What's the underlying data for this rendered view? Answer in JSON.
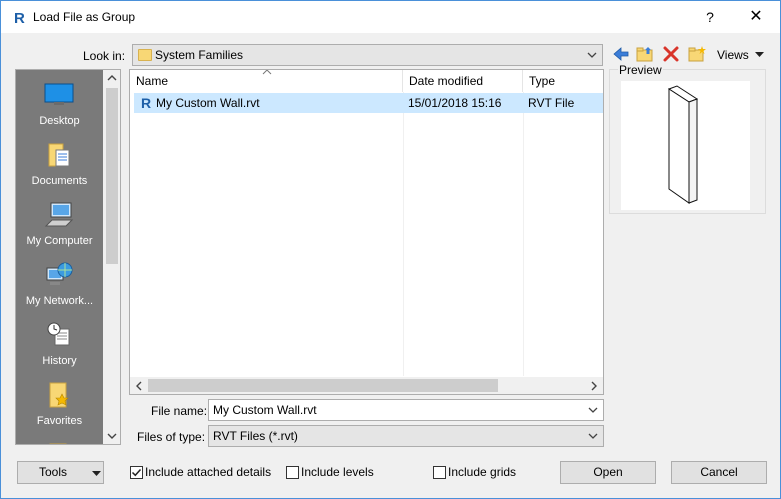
{
  "dialog": {
    "title": "Load File as Group",
    "help_label": "?",
    "close_label": "✕"
  },
  "lookin": {
    "label": "Look in:",
    "value": "System Families"
  },
  "toolbar": {
    "back_icon": "back-arrow-icon",
    "up_folder_icon": "up-folder-icon",
    "delete_icon": "delete-icon",
    "new_folder_icon": "new-folder-icon",
    "views_label": "Views"
  },
  "places": [
    {
      "label": "Desktop",
      "icon": "desktop-icon"
    },
    {
      "label": "Documents",
      "icon": "documents-icon"
    },
    {
      "label": "My Computer",
      "icon": "computer-icon"
    },
    {
      "label": "My Network...",
      "icon": "network-icon"
    },
    {
      "label": "History",
      "icon": "history-icon"
    },
    {
      "label": "Favorites",
      "icon": "favorites-icon"
    }
  ],
  "filelist": {
    "columns": [
      "Name",
      "Date modified",
      "Type"
    ],
    "rows": [
      {
        "name": "My Custom Wall.rvt",
        "date": "15/01/2018 15:16",
        "type": "RVT File",
        "selected": true
      }
    ]
  },
  "preview": {
    "label": "Preview"
  },
  "filename": {
    "label": "File name:",
    "value": "My Custom Wall.rvt"
  },
  "filetype": {
    "label": "Files of type:",
    "value": "RVT Files  (*.rvt)"
  },
  "footer": {
    "tools_label": "Tools",
    "include_details_label": "Include attached details",
    "include_details_checked": true,
    "include_levels_label": "Include levels",
    "include_levels_checked": false,
    "include_grids_label": "Include grids",
    "include_grids_checked": false,
    "open_label": "Open",
    "cancel_label": "Cancel"
  },
  "colors": {
    "selection": "#cce8ff",
    "places_bg": "#7a7a7a",
    "revit_blue": "#1d5fa8"
  }
}
